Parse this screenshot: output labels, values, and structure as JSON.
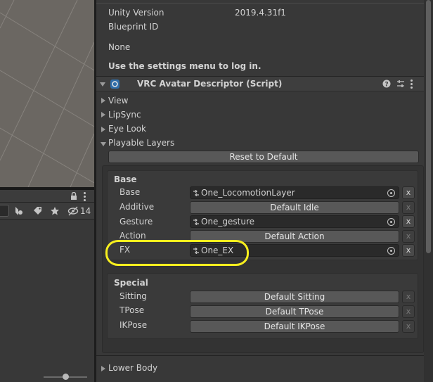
{
  "hierarchy": {
    "visible_count": "14"
  },
  "info": {
    "unity_version_label": "Unity Version",
    "unity_version_value": "2019.4.31f1",
    "blueprint_id_label": "Blueprint ID",
    "blueprint_id_value": "None",
    "login_message": "Use the settings menu to log in."
  },
  "component": {
    "title": "VRC Avatar Descriptor (Script)",
    "icons": [
      "help-icon",
      "preset-icon",
      "kebab-menu-icon"
    ],
    "foldouts": {
      "view": "View",
      "lipsync": "LipSync",
      "eye_look": "Eye Look",
      "playable_layers": "Playable Layers",
      "lower_body": "Lower Body"
    },
    "reset_label": "Reset to Default"
  },
  "base_layers": {
    "title": "Base",
    "rows": [
      {
        "label": "Base",
        "value": "One_LocomotionLayer",
        "kind": "field"
      },
      {
        "label": "Additive",
        "value": "Default Idle",
        "kind": "button"
      },
      {
        "label": "Gesture",
        "value": "One_gesture",
        "kind": "field"
      },
      {
        "label": "Action",
        "value": "Default Action",
        "kind": "button"
      },
      {
        "label": "FX",
        "value": "One_EX",
        "kind": "field"
      }
    ]
  },
  "special_layers": {
    "title": "Special",
    "rows": [
      {
        "label": "Sitting",
        "value": "Default Sitting"
      },
      {
        "label": "TPose",
        "value": "Default TPose"
      },
      {
        "label": "IKPose",
        "value": "Default IKPose"
      }
    ]
  },
  "remove_label": "x",
  "colors": {
    "highlight": "#f7ef1e",
    "panel": "#383838",
    "scene": "#6b6762"
  }
}
